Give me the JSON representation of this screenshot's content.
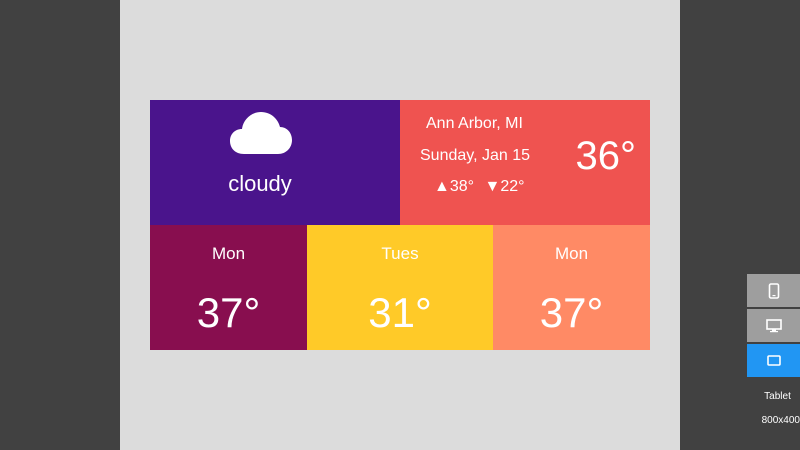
{
  "weather": {
    "condition": "cloudy",
    "condition_icon": "cloud-icon",
    "location": "Ann Arbor, MI",
    "date": "Sunday, Jan 15",
    "high": "▲38°",
    "low": "▼22°",
    "current_temp": "36°",
    "colors": {
      "condition_bg": "#4a148c",
      "today_bg": "#ef5350"
    },
    "forecast": [
      {
        "day": "Mon",
        "temp": "37°",
        "color": "#880e4f"
      },
      {
        "day": "Tues",
        "temp": "31°",
        "color": "#ffca28"
      },
      {
        "day": "Mon",
        "temp": "37°",
        "color": "#ff8a65"
      }
    ]
  },
  "device_toolbar": {
    "buttons": [
      {
        "name": "phone",
        "icon": "phone-icon",
        "active": false
      },
      {
        "name": "desktop",
        "icon": "monitor-icon",
        "active": false
      },
      {
        "name": "tablet",
        "icon": "tablet-icon",
        "active": true
      }
    ],
    "active_label": "Tablet",
    "active_size": "800x400",
    "active_color": "#2196f3"
  }
}
